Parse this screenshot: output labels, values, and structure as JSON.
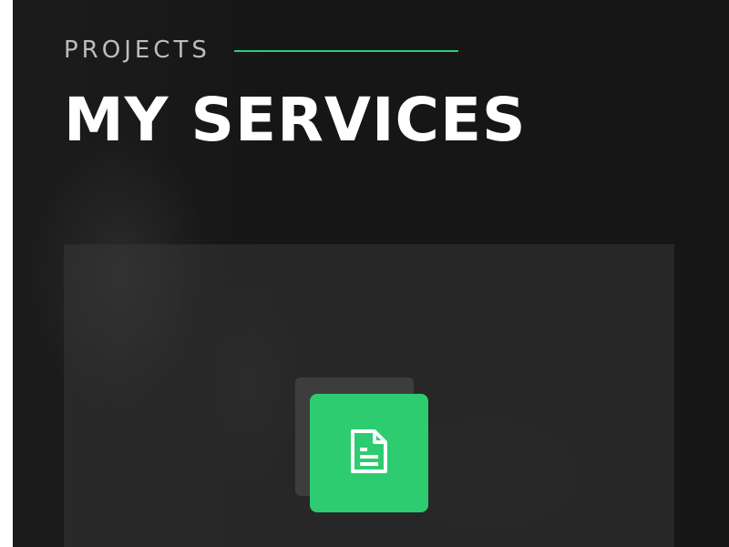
{
  "header": {
    "eyebrow": "PROJECTS",
    "title": "MY SERVICES"
  },
  "service_card": {
    "icon": "document-icon"
  },
  "colors": {
    "accent": "#2ecc71",
    "background": "#161616",
    "card": "#2a2a2a",
    "title_text": "#ffffff",
    "eyebrow_text": "#bdbdbd"
  }
}
